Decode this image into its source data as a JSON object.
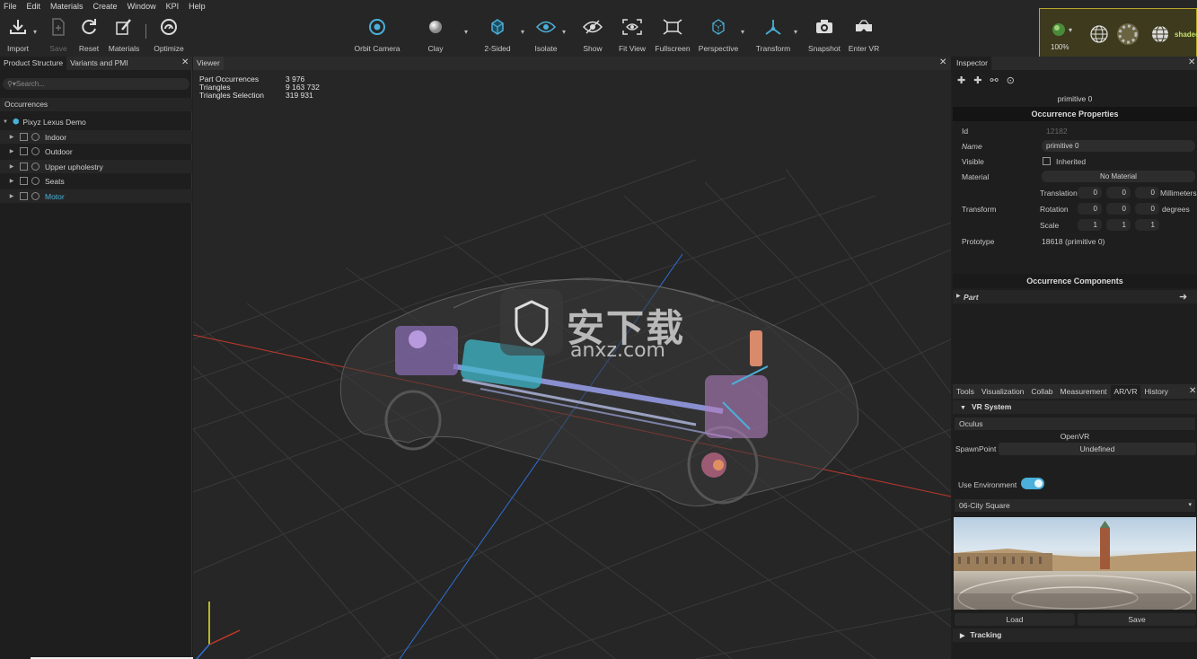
{
  "menu": [
    "File",
    "Edit",
    "Materials",
    "Create",
    "Window",
    "KPI",
    "Help"
  ],
  "toolbar": {
    "import": "Import",
    "save": "Save",
    "reset": "Reset",
    "materials": "Materials",
    "optimize": "Optimize",
    "orbit_camera": "Orbit Camera",
    "clay": "Clay",
    "two_sided": "2-Sided",
    "isolate": "Isolate",
    "show": "Show",
    "fit_view": "Fit View",
    "fullscreen": "Fullscreen",
    "perspective": "Perspective",
    "transform": "Transform",
    "snapshot": "Snapshot",
    "enter_vr": "Enter VR"
  },
  "vr_box": {
    "zoom": "100%",
    "shaded": "shadec"
  },
  "left_panel": {
    "tabs": [
      "Product Structure",
      "Variants and PMI"
    ],
    "search_placeholder": "Search...",
    "occurrences_header": "Occurrences",
    "root": "Pixyz Lexus Demo",
    "items": [
      "Indoor",
      "Outdoor",
      "Upper upholestry",
      "Seats",
      "Motor"
    ]
  },
  "viewer": {
    "tab": "Viewer",
    "stats": [
      {
        "label": "Part Occurrences",
        "value": "3 976"
      },
      {
        "label": "Triangles",
        "value": "9 163 732"
      },
      {
        "label": "Triangles Selection",
        "value": "319 931"
      }
    ],
    "watermark_cn": "安下载",
    "watermark_url": "anxz.com"
  },
  "inspector": {
    "tab": "Inspector",
    "object_name": "primitive 0",
    "occ_props_title": "Occurrence Properties",
    "id_label": "Id",
    "id_value": "12182",
    "name_label": "Name",
    "name_value": "primitive 0",
    "visible_label": "Visible",
    "visible_value": "Inherited",
    "material_label": "Material",
    "material_value": "No Material",
    "transform_label": "Transform",
    "translation_label": "Translation",
    "translation": [
      "0",
      "0",
      "0"
    ],
    "translation_unit": "Millimeters",
    "rotation_label": "Rotation",
    "rotation": [
      "0",
      "0",
      "0"
    ],
    "rotation_unit": "degrees",
    "scale_label": "Scale",
    "scale": [
      "1",
      "1",
      "1"
    ],
    "prototype_label": "Prototype",
    "prototype_value": "18618 (primitive 0)",
    "components_title": "Occurrence Components",
    "part_label": "Part"
  },
  "bottom_panel": {
    "tabs": [
      "Tools",
      "Visualization",
      "Collab",
      "Measurement",
      "AR/VR",
      "History"
    ],
    "vr_system": "VR System",
    "device": "Oculus",
    "runtime": "OpenVR",
    "spawn_label": "SpawnPoint",
    "spawn_value": "Undefined",
    "use_env_label": "Use Environment",
    "environment": "06-City Square",
    "load": "Load",
    "save": "Save",
    "tracking": "Tracking"
  },
  "colors": {
    "accent": "#4ab0d9",
    "x_axis": "#c0392b",
    "y_axis": "#2f6fd6",
    "z_axis": "#e6e62c"
  }
}
